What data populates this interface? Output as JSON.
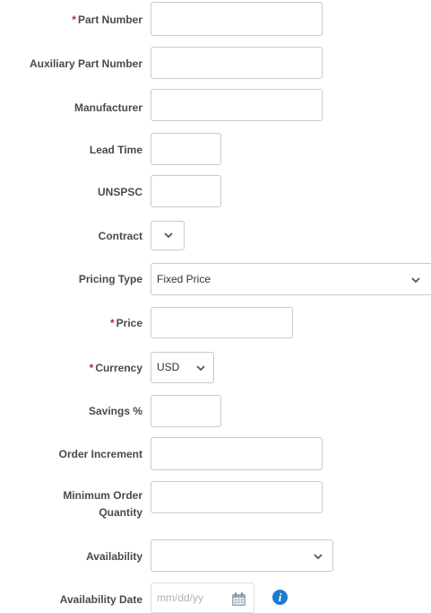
{
  "form": {
    "part_number": {
      "label": "Part Number",
      "required_mark": "*"
    },
    "auxiliary_part_number": {
      "label": "Auxiliary Part Number"
    },
    "manufacturer": {
      "label": "Manufacturer"
    },
    "lead_time": {
      "label": "Lead Time"
    },
    "unspsc": {
      "label": "UNSPSC"
    },
    "contract": {
      "label": "Contract"
    },
    "pricing_type": {
      "label": "Pricing Type",
      "selected": "Fixed Price"
    },
    "price": {
      "label": "Price",
      "required_mark": "*"
    },
    "currency": {
      "label": "Currency",
      "required_mark": "*",
      "selected": "USD"
    },
    "savings": {
      "label": "Savings %"
    },
    "order_increment": {
      "label": "Order Increment"
    },
    "minimum_order_quantity": {
      "label": "Minimum Order Quantity"
    },
    "availability": {
      "label": "Availability",
      "selected": ""
    },
    "availability_date": {
      "label": "Availability Date",
      "placeholder": "mm/dd/yy"
    }
  },
  "icons": {
    "chevron": "chevron-down-icon",
    "calendar": "calendar-icon",
    "info": "info-icon"
  },
  "colors": {
    "required": "#c8202f",
    "label": "#4a4a4a",
    "border": "#c9c9c9",
    "info": "#1f7ad1"
  }
}
